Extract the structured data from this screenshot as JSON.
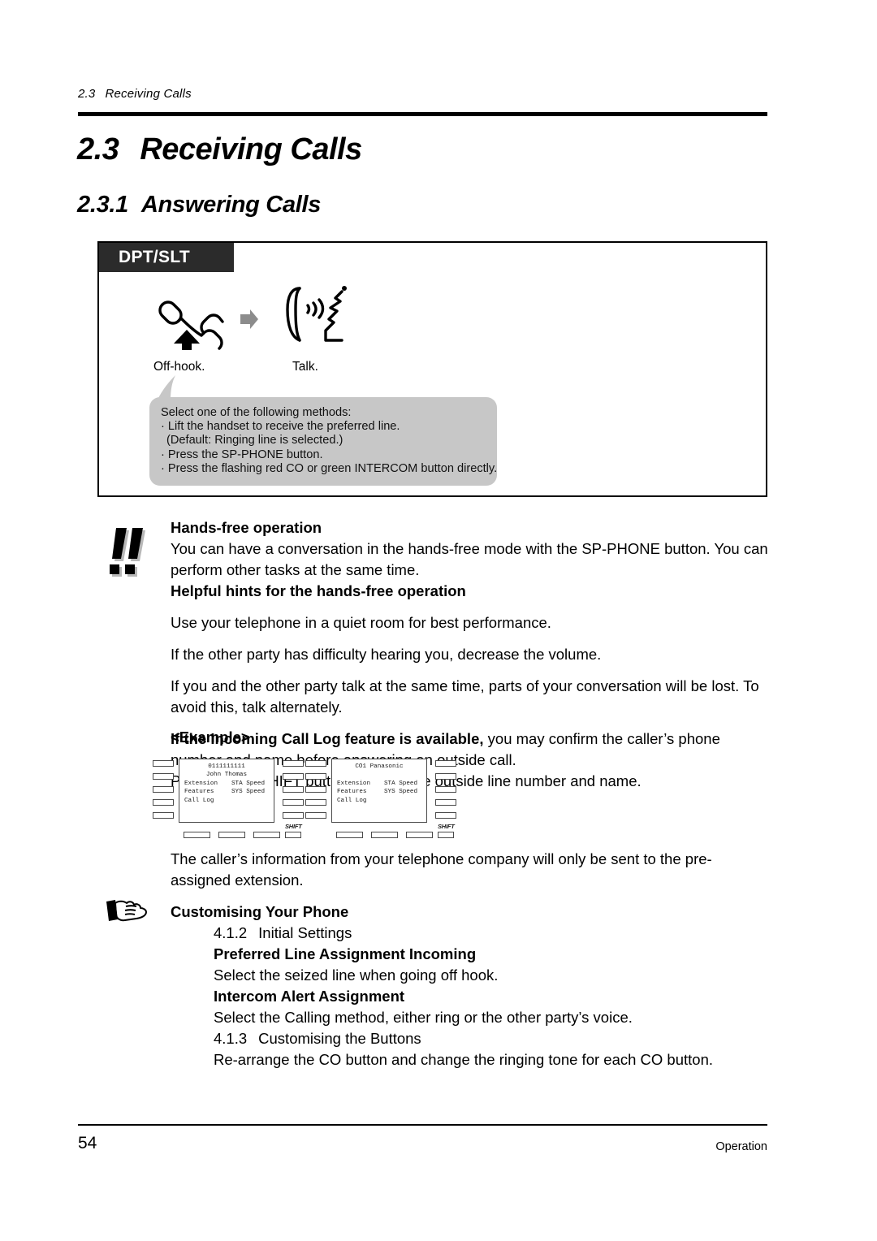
{
  "running_header": {
    "number": "2.3",
    "text": "Receiving Calls"
  },
  "title": {
    "number": "2.3",
    "text": "Receiving Calls"
  },
  "subtitle": {
    "number": "2.3.1",
    "text": "Answering Calls"
  },
  "procedure_box": {
    "tab_label": "DPT/SLT",
    "steps": [
      {
        "icon": "offhook-handset-icon",
        "label": "Off-hook."
      },
      {
        "icon": "right-arrow-icon",
        "label": ""
      },
      {
        "icon": "talking-handset-icon",
        "label": "Talk."
      }
    ],
    "bubble": {
      "lines": [
        "Select one of the following methods:",
        "· Lift the handset to receive the preferred line.",
        "(Default: Ringing line is selected.)",
        "· Press the SP-PHONE button.",
        "· Press the flashing red CO or green INTERCOM button directly."
      ],
      "bg_color": "#c7c7c7"
    }
  },
  "notice": {
    "icon": "double-exclamation-icon",
    "heading": "Hands-free operation",
    "para1": "You can have a conversation in the hands-free mode with the SP-PHONE button. You can perform other tasks at the same time.",
    "heading2": "Helpful hints for the hands-free operation",
    "para2": "Use your telephone in a quiet room for best performance.",
    "para3": "If the other party has difficulty hearing you, decrease the volume.",
    "para4": "If you and the other party talk at the same time, parts of your conversation will be lost. To avoid this, talk alternately.",
    "para5_bold": "If the Incoming Call Log feature is available,",
    "para5_rest": " you may confirm the caller’s phone number and name before answering an outside call.",
    "para6": "Pressing the SHIFT button displays the outside line number and name.",
    "example_label": "<Example>"
  },
  "example": {
    "displays": [
      {
        "name": "display-with-caller-id",
        "lines": [
          {
            "type": "center",
            "text": "0111111111"
          },
          {
            "type": "center",
            "text": "John Thomas"
          },
          {
            "type": "row",
            "c1": "Extension",
            "c2": "STA Speed"
          },
          {
            "type": "row",
            "c1": "Features",
            "c2": "SYS Speed"
          },
          {
            "type": "row",
            "c1": "Call Log",
            "c2": ""
          }
        ],
        "shift_label": "SHIFT"
      },
      {
        "name": "display-with-line-name",
        "lines": [
          {
            "type": "center",
            "text": "CO1 Panasonic"
          },
          {
            "type": "center",
            "text": ""
          },
          {
            "type": "row",
            "c1": "Extension",
            "c2": "STA Speed"
          },
          {
            "type": "row",
            "c1": "Features",
            "c2": "SYS Speed"
          },
          {
            "type": "row",
            "c1": "Call Log",
            "c2": ""
          }
        ],
        "shift_label": "SHIFT"
      }
    ]
  },
  "customising": {
    "note": "The caller’s information from your telephone company will only be sent to the pre-assigned extension.",
    "icon": "pointing-hand-icon",
    "heading": "Customising Your Phone",
    "items": [
      {
        "number": "4.1.2",
        "title": "Initial Settings"
      },
      {
        "bold": "Preferred Line Assignment   Incoming"
      },
      {
        "text": "Select the seized line when going off hook."
      },
      {
        "bold": "Intercom Alert Assignment"
      },
      {
        "text": "Select the Calling method, either ring or the other party’s voice."
      },
      {
        "number": "4.1.3",
        "title": "Customising the Buttons"
      },
      {
        "text": "Re-arrange the CO button and change the ringing tone for each CO button."
      }
    ]
  },
  "footer": {
    "page_number": "54",
    "section": "Operation"
  }
}
